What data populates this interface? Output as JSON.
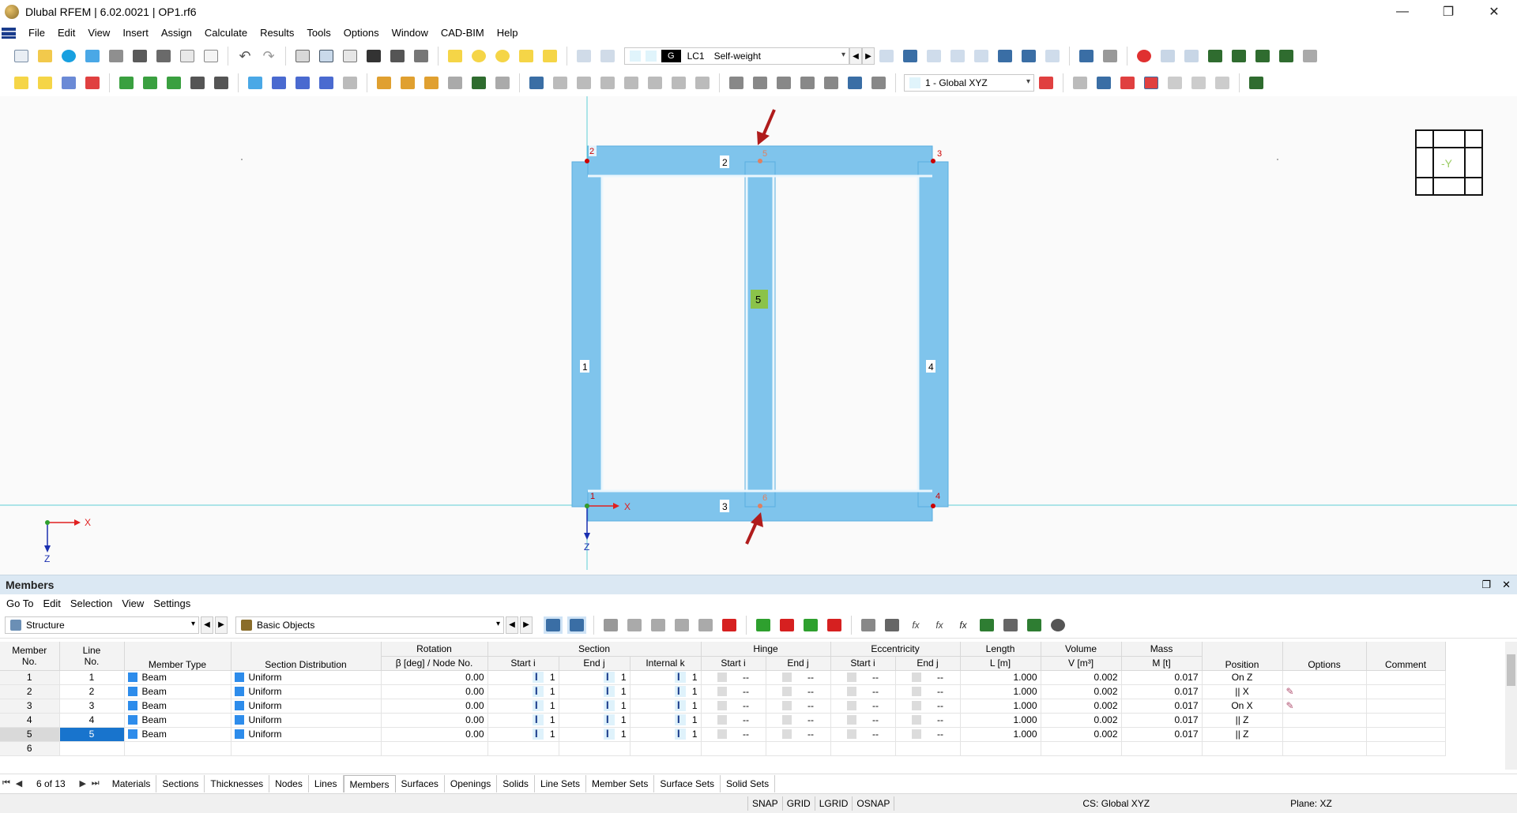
{
  "window": {
    "title": "Dlubal RFEM | 6.02.0021 | OP1.rf6",
    "minimize": "—",
    "restore": "❐",
    "close": "✕"
  },
  "menu": [
    "File",
    "Edit",
    "View",
    "Insert",
    "Assign",
    "Calculate",
    "Results",
    "Tools",
    "Options",
    "Window",
    "CAD-BIM",
    "Help"
  ],
  "toolbar": {
    "load_case_tag": "G",
    "load_case_id": "LC1",
    "load_case_name": "Self-weight",
    "coord_system": "1 - Global XYZ"
  },
  "viewport": {
    "view_cube_label": "-Y",
    "axis_x": "X",
    "axis_z": "Z",
    "node_labels": [
      "1",
      "2",
      "3",
      "4",
      "5",
      "6"
    ],
    "member_labels": [
      "1",
      "2",
      "3",
      "4",
      "5"
    ],
    "accent_member_color": "#8bc34a",
    "member_color": "#7fc4ec",
    "arrow_color": "#b01c1c"
  },
  "panel": {
    "title": "Members",
    "menu": [
      "Go To",
      "Edit",
      "Selection",
      "View",
      "Settings"
    ],
    "filter_combo": "Structure",
    "objects_combo": "Basic Objects",
    "table": {
      "header_groups": {
        "member_no": "Member\nNo.",
        "line_no": "Line\nNo.",
        "member_type": "Member Type",
        "section_distribution": "Section Distribution",
        "rotation": "Rotation",
        "rotation_sub": "β [deg] / Node No.",
        "section": "Section",
        "section_start": "Start i",
        "section_end": "End j",
        "section_internal": "Internal k",
        "hinge": "Hinge",
        "hinge_start": "Start i",
        "hinge_end": "End j",
        "eccentricity": "Eccentricity",
        "ecc_start": "Start i",
        "ecc_end": "End j",
        "length": "Length",
        "length_unit": "L [m]",
        "volume": "Volume",
        "volume_unit": "V [m³]",
        "mass": "Mass",
        "mass_unit": "M [t]",
        "position": "Position",
        "options": "Options",
        "comment": "Comment"
      },
      "rows": [
        {
          "no": "1",
          "line": "1",
          "type": "Beam",
          "dist": "Uniform",
          "rot": "0.00",
          "s_start": "1",
          "s_end": "1",
          "s_int": "1",
          "h_start": "--",
          "h_end": "--",
          "e_start": "--",
          "e_end": "--",
          "length": "1.000",
          "volume": "0.002",
          "mass": "0.017",
          "position": "On Z",
          "options": ""
        },
        {
          "no": "2",
          "line": "2",
          "type": "Beam",
          "dist": "Uniform",
          "rot": "0.00",
          "s_start": "1",
          "s_end": "1",
          "s_int": "1",
          "h_start": "--",
          "h_end": "--",
          "e_start": "--",
          "e_end": "--",
          "length": "1.000",
          "volume": "0.002",
          "mass": "0.017",
          "position": "|| X",
          "options": "✎"
        },
        {
          "no": "3",
          "line": "3",
          "type": "Beam",
          "dist": "Uniform",
          "rot": "0.00",
          "s_start": "1",
          "s_end": "1",
          "s_int": "1",
          "h_start": "--",
          "h_end": "--",
          "e_start": "--",
          "e_end": "--",
          "length": "1.000",
          "volume": "0.002",
          "mass": "0.017",
          "position": "On X",
          "options": "✎"
        },
        {
          "no": "4",
          "line": "4",
          "type": "Beam",
          "dist": "Uniform",
          "rot": "0.00",
          "s_start": "1",
          "s_end": "1",
          "s_int": "1",
          "h_start": "--",
          "h_end": "--",
          "e_start": "--",
          "e_end": "--",
          "length": "1.000",
          "volume": "0.002",
          "mass": "0.017",
          "position": "|| Z",
          "options": ""
        },
        {
          "no": "5",
          "line": "5",
          "type": "Beam",
          "dist": "Uniform",
          "rot": "0.00",
          "s_start": "1",
          "s_end": "1",
          "s_int": "1",
          "h_start": "--",
          "h_end": "--",
          "e_start": "--",
          "e_end": "--",
          "length": "1.000",
          "volume": "0.002",
          "mass": "0.017",
          "position": "|| Z",
          "options": ""
        },
        {
          "no": "6",
          "line": "",
          "type": "",
          "dist": "",
          "rot": "",
          "s_start": "",
          "s_end": "",
          "s_int": "",
          "h_start": "",
          "h_end": "",
          "e_start": "",
          "e_end": "",
          "length": "",
          "volume": "",
          "mass": "",
          "position": "",
          "options": ""
        }
      ]
    },
    "page_indicator": "6 of 13",
    "tabs": [
      "Materials",
      "Sections",
      "Thicknesses",
      "Nodes",
      "Lines",
      "Members",
      "Surfaces",
      "Openings",
      "Solids",
      "Line Sets",
      "Member Sets",
      "Surface Sets",
      "Solid Sets"
    ],
    "active_tab": "Members"
  },
  "status": {
    "buttons": [
      "SNAP",
      "GRID",
      "LGRID",
      "OSNAP"
    ],
    "cs": "CS: Global XYZ",
    "plane": "Plane: XZ"
  }
}
